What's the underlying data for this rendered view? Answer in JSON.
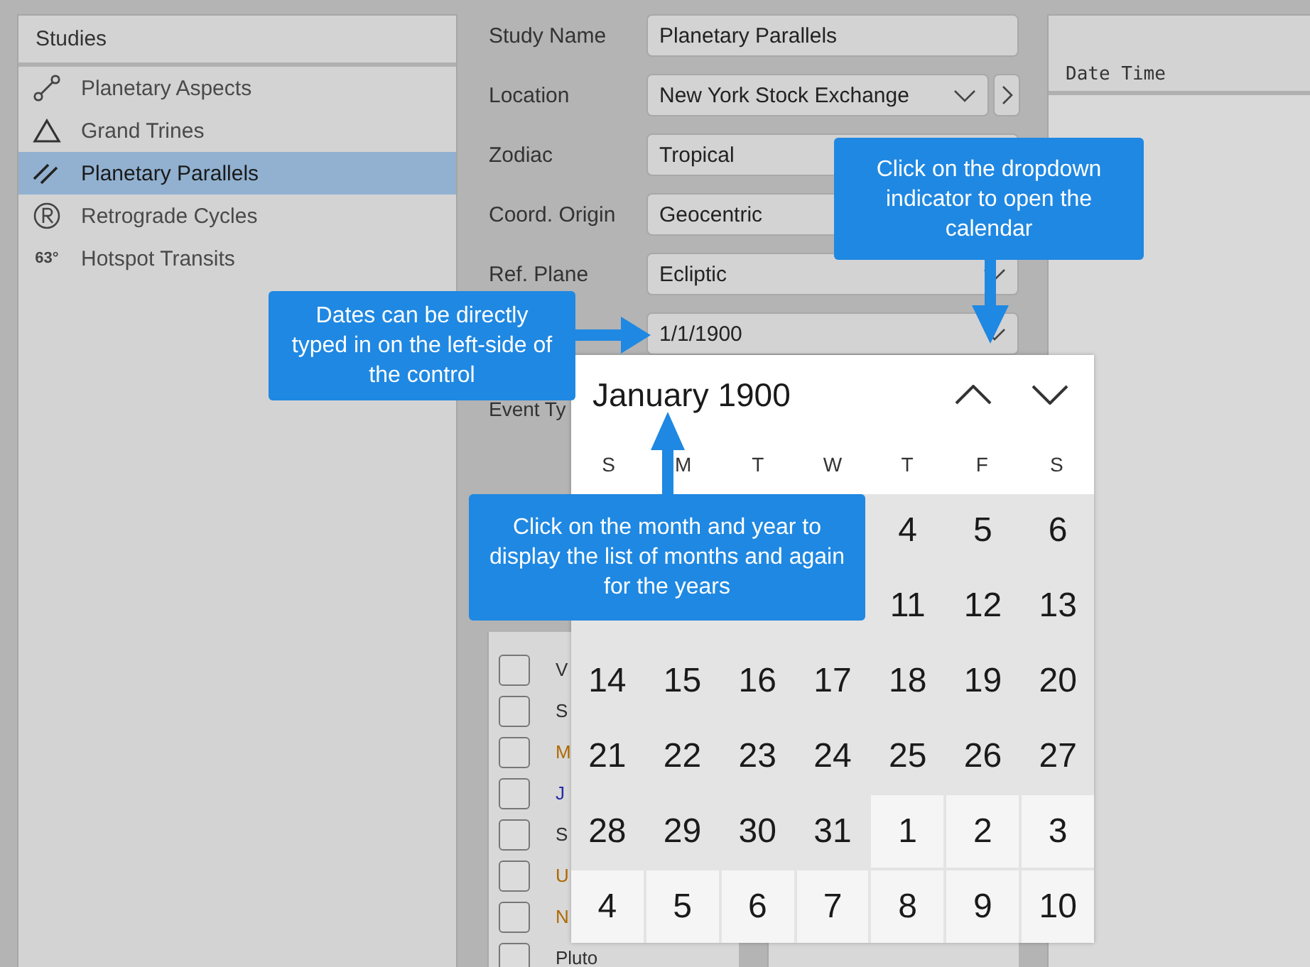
{
  "sidebar": {
    "title": "Studies",
    "items": [
      {
        "label": "Planetary Aspects",
        "selected": false
      },
      {
        "label": "Grand Trines",
        "selected": false
      },
      {
        "label": "Planetary Parallels",
        "selected": true
      },
      {
        "label": "Retrograde Cycles",
        "selected": false
      },
      {
        "label": "Hotspot Transits",
        "badge": "63°",
        "selected": false
      }
    ]
  },
  "form": {
    "fields": [
      {
        "label": "Study Name",
        "value": "Planetary Parallels",
        "kind": "text"
      },
      {
        "label": "Location",
        "value": "New York Stock Exchange",
        "kind": "location"
      },
      {
        "label": "Zodiac",
        "value": "Tropical",
        "kind": "text"
      },
      {
        "label": "Coord. Origin",
        "value": "Geocentric",
        "kind": "text"
      },
      {
        "label": "Ref. Plane",
        "value": "Ecliptic",
        "kind": "select"
      },
      {
        "value": "1/1/1900",
        "kind": "select"
      }
    ],
    "event_type_label": "Event Ty",
    "planet_columns": [
      [
        {
          "label": "V",
          "checked": false,
          "color": "#303030"
        },
        {
          "label": "S",
          "checked": false,
          "color": "#303030"
        },
        {
          "label": "M",
          "checked": false,
          "color": "#b06a00"
        },
        {
          "label": "J",
          "checked": false,
          "color": "#2a2aa8"
        },
        {
          "label": "S",
          "checked": false,
          "color": "#303030"
        },
        {
          "label": "U",
          "checked": false,
          "color": "#b06a00"
        },
        {
          "label": "N",
          "checked": false,
          "color": "#b06a00"
        },
        {
          "label": "Pluto",
          "checked": false,
          "color": "#303030"
        }
      ],
      []
    ]
  },
  "table": {
    "columns": [
      "Date Time"
    ]
  },
  "calendar": {
    "title": "January 1900",
    "weekdays": [
      "S",
      "M",
      "T",
      "W",
      "T",
      "F",
      "S"
    ],
    "days": [
      {
        "kind": "covered"
      },
      {
        "kind": "covered"
      },
      {
        "kind": "covered"
      },
      {
        "kind": "covered"
      },
      {
        "kind": "day",
        "label": "4",
        "in_month": true
      },
      {
        "kind": "day",
        "label": "5",
        "in_month": true
      },
      {
        "kind": "day",
        "label": "6",
        "in_month": true
      },
      {
        "kind": "covered"
      },
      {
        "kind": "covered"
      },
      {
        "kind": "covered"
      },
      {
        "kind": "covered"
      },
      {
        "kind": "day",
        "label": "11",
        "in_month": true
      },
      {
        "kind": "day",
        "label": "12",
        "in_month": true
      },
      {
        "kind": "day",
        "label": "13",
        "in_month": true
      },
      {
        "kind": "day",
        "label": "14",
        "in_month": true
      },
      {
        "kind": "day",
        "label": "15",
        "in_month": true
      },
      {
        "kind": "day",
        "label": "16",
        "in_month": true
      },
      {
        "kind": "day",
        "label": "17",
        "in_month": true
      },
      {
        "kind": "day",
        "label": "18",
        "in_month": true
      },
      {
        "kind": "day",
        "label": "19",
        "in_month": true
      },
      {
        "kind": "day",
        "label": "20",
        "in_month": true
      },
      {
        "kind": "day",
        "label": "21",
        "in_month": true
      },
      {
        "kind": "day",
        "label": "22",
        "in_month": true
      },
      {
        "kind": "day",
        "label": "23",
        "in_month": true
      },
      {
        "kind": "day",
        "label": "24",
        "in_month": true
      },
      {
        "kind": "day",
        "label": "25",
        "in_month": true
      },
      {
        "kind": "day",
        "label": "26",
        "in_month": true
      },
      {
        "kind": "day",
        "label": "27",
        "in_month": true
      },
      {
        "kind": "day",
        "label": "28",
        "in_month": true
      },
      {
        "kind": "day",
        "label": "29",
        "in_month": true
      },
      {
        "kind": "day",
        "label": "30",
        "in_month": true
      },
      {
        "kind": "day",
        "label": "31",
        "in_month": true
      },
      {
        "kind": "day",
        "label": "1",
        "in_month": false
      },
      {
        "kind": "day",
        "label": "2",
        "in_month": false
      },
      {
        "kind": "day",
        "label": "3",
        "in_month": false
      },
      {
        "kind": "day",
        "label": "4",
        "in_month": false
      },
      {
        "kind": "day",
        "label": "5",
        "in_month": false
      },
      {
        "kind": "day",
        "label": "6",
        "in_month": false
      },
      {
        "kind": "day",
        "label": "7",
        "in_month": false
      },
      {
        "kind": "day",
        "label": "8",
        "in_month": false
      },
      {
        "kind": "day",
        "label": "9",
        "in_month": false
      },
      {
        "kind": "day",
        "label": "10",
        "in_month": false
      }
    ]
  },
  "callouts": [
    {
      "text": "Dates can be directly typed in on the left-side of the control"
    },
    {
      "text": "Click on the dropdown indicator to open the calendar"
    },
    {
      "text": "Click on the month and year to display the list of months and again for the years"
    }
  ]
}
